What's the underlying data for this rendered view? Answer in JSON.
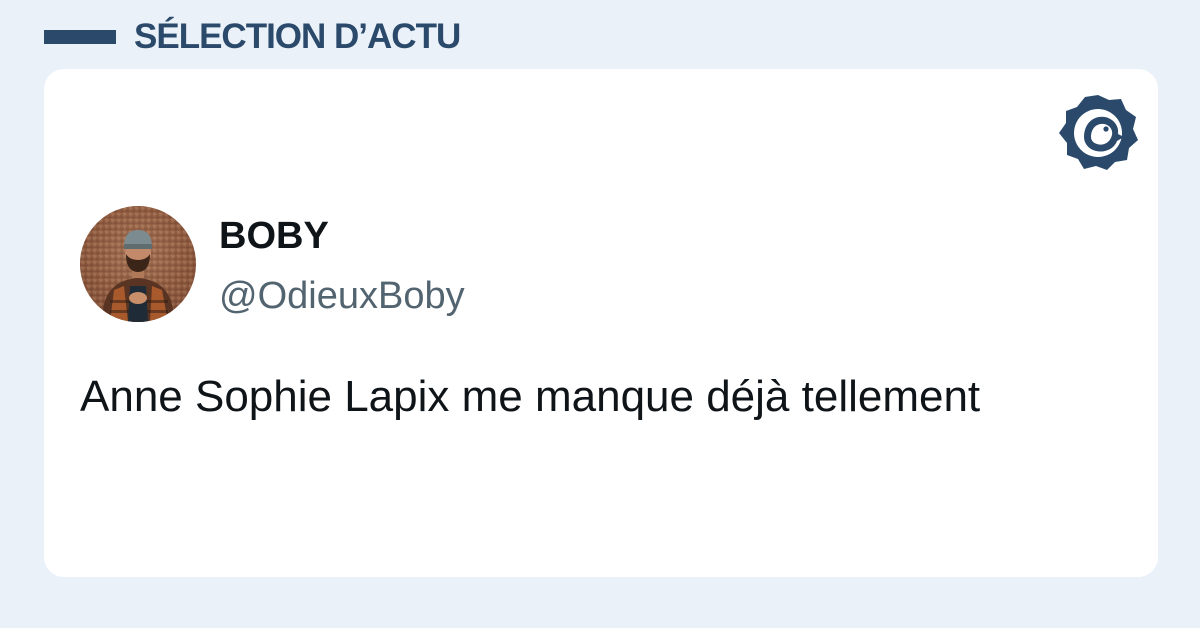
{
  "header": {
    "title": "SÉLECTION D’ACTU",
    "accent_color": "#2b4a6b"
  },
  "logo": {
    "icon": "chick-badge-icon"
  },
  "tweet": {
    "display_name": "BOBY",
    "handle": "@OdieuxBoby",
    "text": "Anne Sophie Lapix me manque déjà tellement",
    "avatar_icon": "user-avatar-photo"
  },
  "colors": {
    "background": "#eaf1f9",
    "card": "#ffffff",
    "text_primary": "#0f1419",
    "text_secondary": "#536471"
  }
}
